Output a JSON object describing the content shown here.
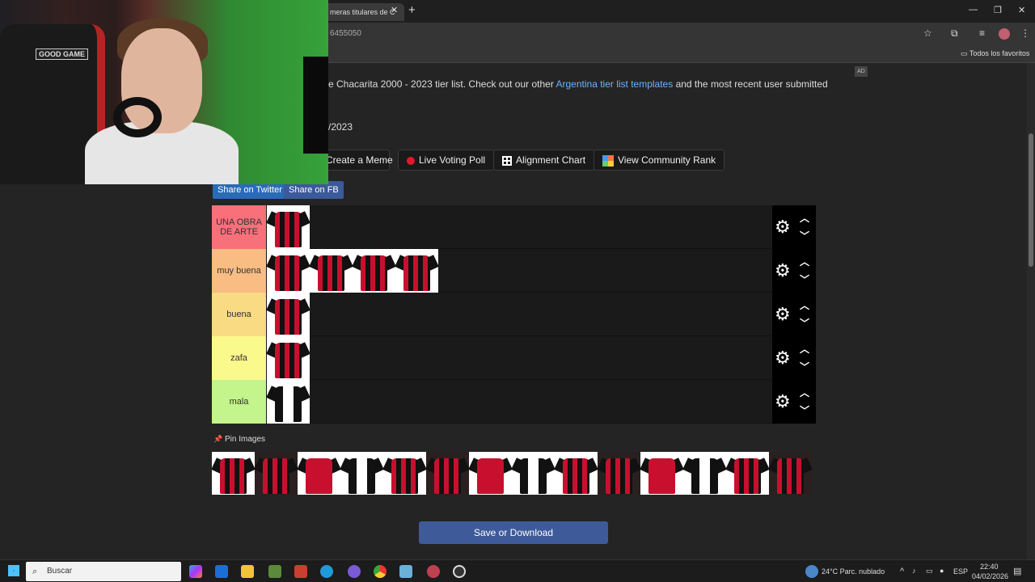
{
  "browser": {
    "tab_title": "meras titulares de C",
    "tab_close": "✕",
    "new_tab": "+",
    "url": "6455050",
    "bookmark": "Todos los favoritos",
    "window_controls": [
      "—",
      "❐",
      "✕"
    ]
  },
  "webcam": {
    "chair_label": "GOOD GAME"
  },
  "page": {
    "intro_prefix": "e Chacarita 2000 - 2023 tier list. Check out our other ",
    "intro_link": "Argentina tier list templates",
    "intro_suffix": " and the most recent user submitted",
    "date": "/2023",
    "ad": "AD"
  },
  "actions": {
    "create_meme": "Create a Meme",
    "live_voting": "Live Voting Poll",
    "alignment_chart": "Alignment Chart",
    "community_rank": "View Community Rank"
  },
  "share": {
    "twitter": "Share on Twitter",
    "fb": "Share on FB"
  },
  "tiers": [
    {
      "label": "UNA OBRA DE ARTE",
      "color": "#f7707a",
      "items": 1
    },
    {
      "label": "muy buena",
      "color": "#f9bc82",
      "items": 4
    },
    {
      "label": "buena",
      "color": "#f9db84",
      "items": 1
    },
    {
      "label": "zafa",
      "color": "#faf98b",
      "items": 1
    },
    {
      "label": "mala",
      "color": "#c4f48c",
      "items": 1
    }
  ],
  "pin": {
    "icon": "📌",
    "label": "Pin Images"
  },
  "save_button": "Save or Download",
  "taskbar": {
    "search_placeholder": "Buscar",
    "weather": "24°C  Parc. nublado",
    "lang": "ESP",
    "time": "22:40",
    "date": "04/02/2026"
  }
}
